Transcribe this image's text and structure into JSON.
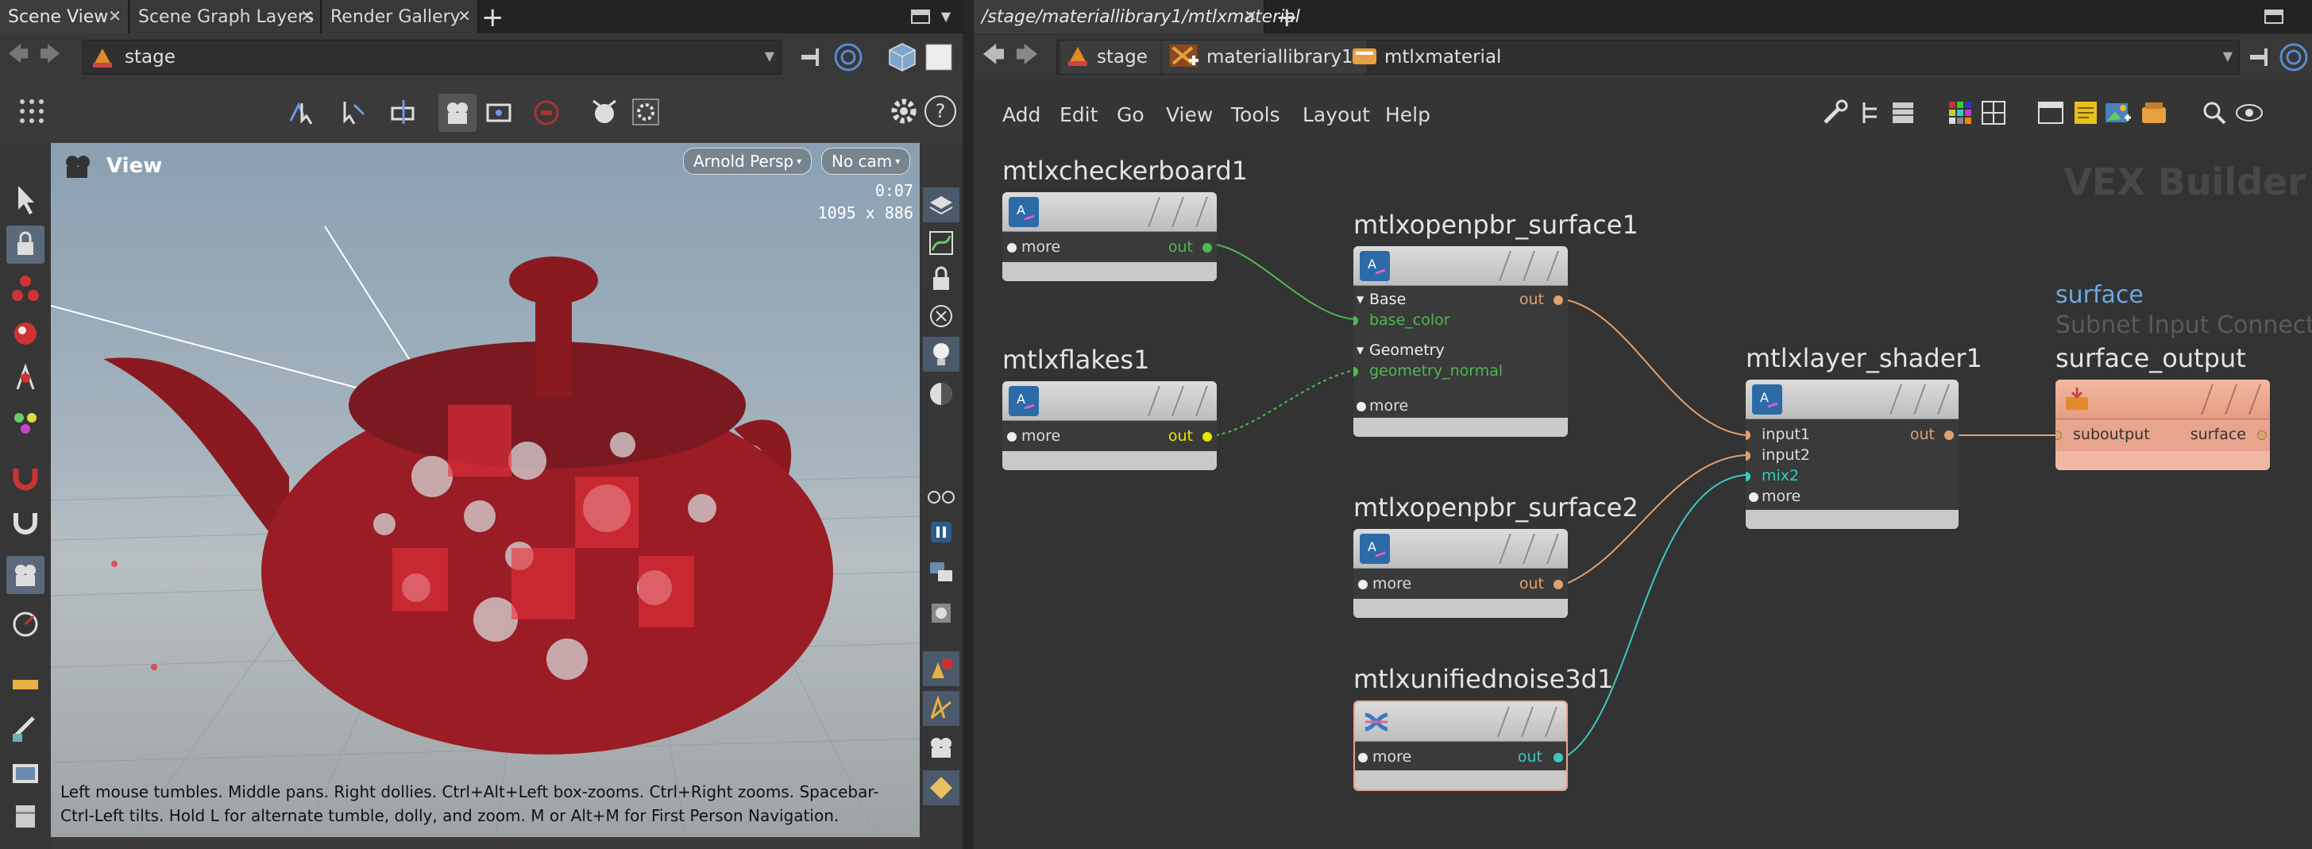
{
  "left_pane": {
    "tabs": [
      {
        "label": "Scene View"
      },
      {
        "label": "Scene Graph Layers"
      },
      {
        "label": "Render Gallery"
      }
    ],
    "path_label": "stage",
    "viewport": {
      "title": "View",
      "camera_dropdown": "Arnold Persp",
      "cam_dropdown": "No cam",
      "time": "0:07",
      "resolution": "1095 x 886",
      "help_text": "Left mouse tumbles. Middle pans. Right dollies. Ctrl+Alt+Left box-zooms. Ctrl+Right zooms. Spacebar-Ctrl-Left tilts. Hold L for alternate tumble, dolly, and zoom. M or Alt+M for First Person Navigation."
    }
  },
  "right_pane": {
    "tab_label": "/stage/materiallibrary1/mtlxmaterial",
    "breadcrumb": [
      {
        "label": "stage"
      },
      {
        "label": "materiallibrary1"
      },
      {
        "label": "mtlxmaterial"
      }
    ],
    "menu": [
      {
        "label": "Add"
      },
      {
        "label": "Edit"
      },
      {
        "label": "Go"
      },
      {
        "label": "View"
      },
      {
        "label": "Tools"
      },
      {
        "label": "Layout"
      },
      {
        "label": "Help"
      }
    ],
    "watermark": "VEX Builder",
    "nodes": {
      "checker": {
        "name": "mtlxcheckerboard1",
        "more": "more",
        "out": "out"
      },
      "flakes": {
        "name": "mtlxflakes1",
        "more": "more",
        "out": "out"
      },
      "pbr1": {
        "name": "mtlxopenpbr_surface1",
        "base": "Base",
        "base_color": "base_color",
        "geometry": "Geometry",
        "geometry_normal": "geometry_normal",
        "more": "more",
        "out": "out"
      },
      "pbr2": {
        "name": "mtlxopenpbr_surface2",
        "more": "more",
        "out": "out"
      },
      "noise": {
        "name": "mtlxunifiednoise3d1",
        "more": "more",
        "out": "out"
      },
      "layer": {
        "name": "mtlxlayer_shader1",
        "input1": "input1",
        "input2": "input2",
        "mix2": "mix2",
        "more": "more",
        "out": "out"
      },
      "output": {
        "subtitle": "surface",
        "connector_label": "Subnet Input Connector",
        "name": "surface_output",
        "suboutput": "suboutput",
        "surface": "surface"
      }
    }
  },
  "colors": {
    "green_wire": "#4fb84f",
    "orange_wire": "#e0a070",
    "teal_wire": "#39c8c0",
    "yellow_port": "#e6e600",
    "output_node": "#e8a48c"
  }
}
